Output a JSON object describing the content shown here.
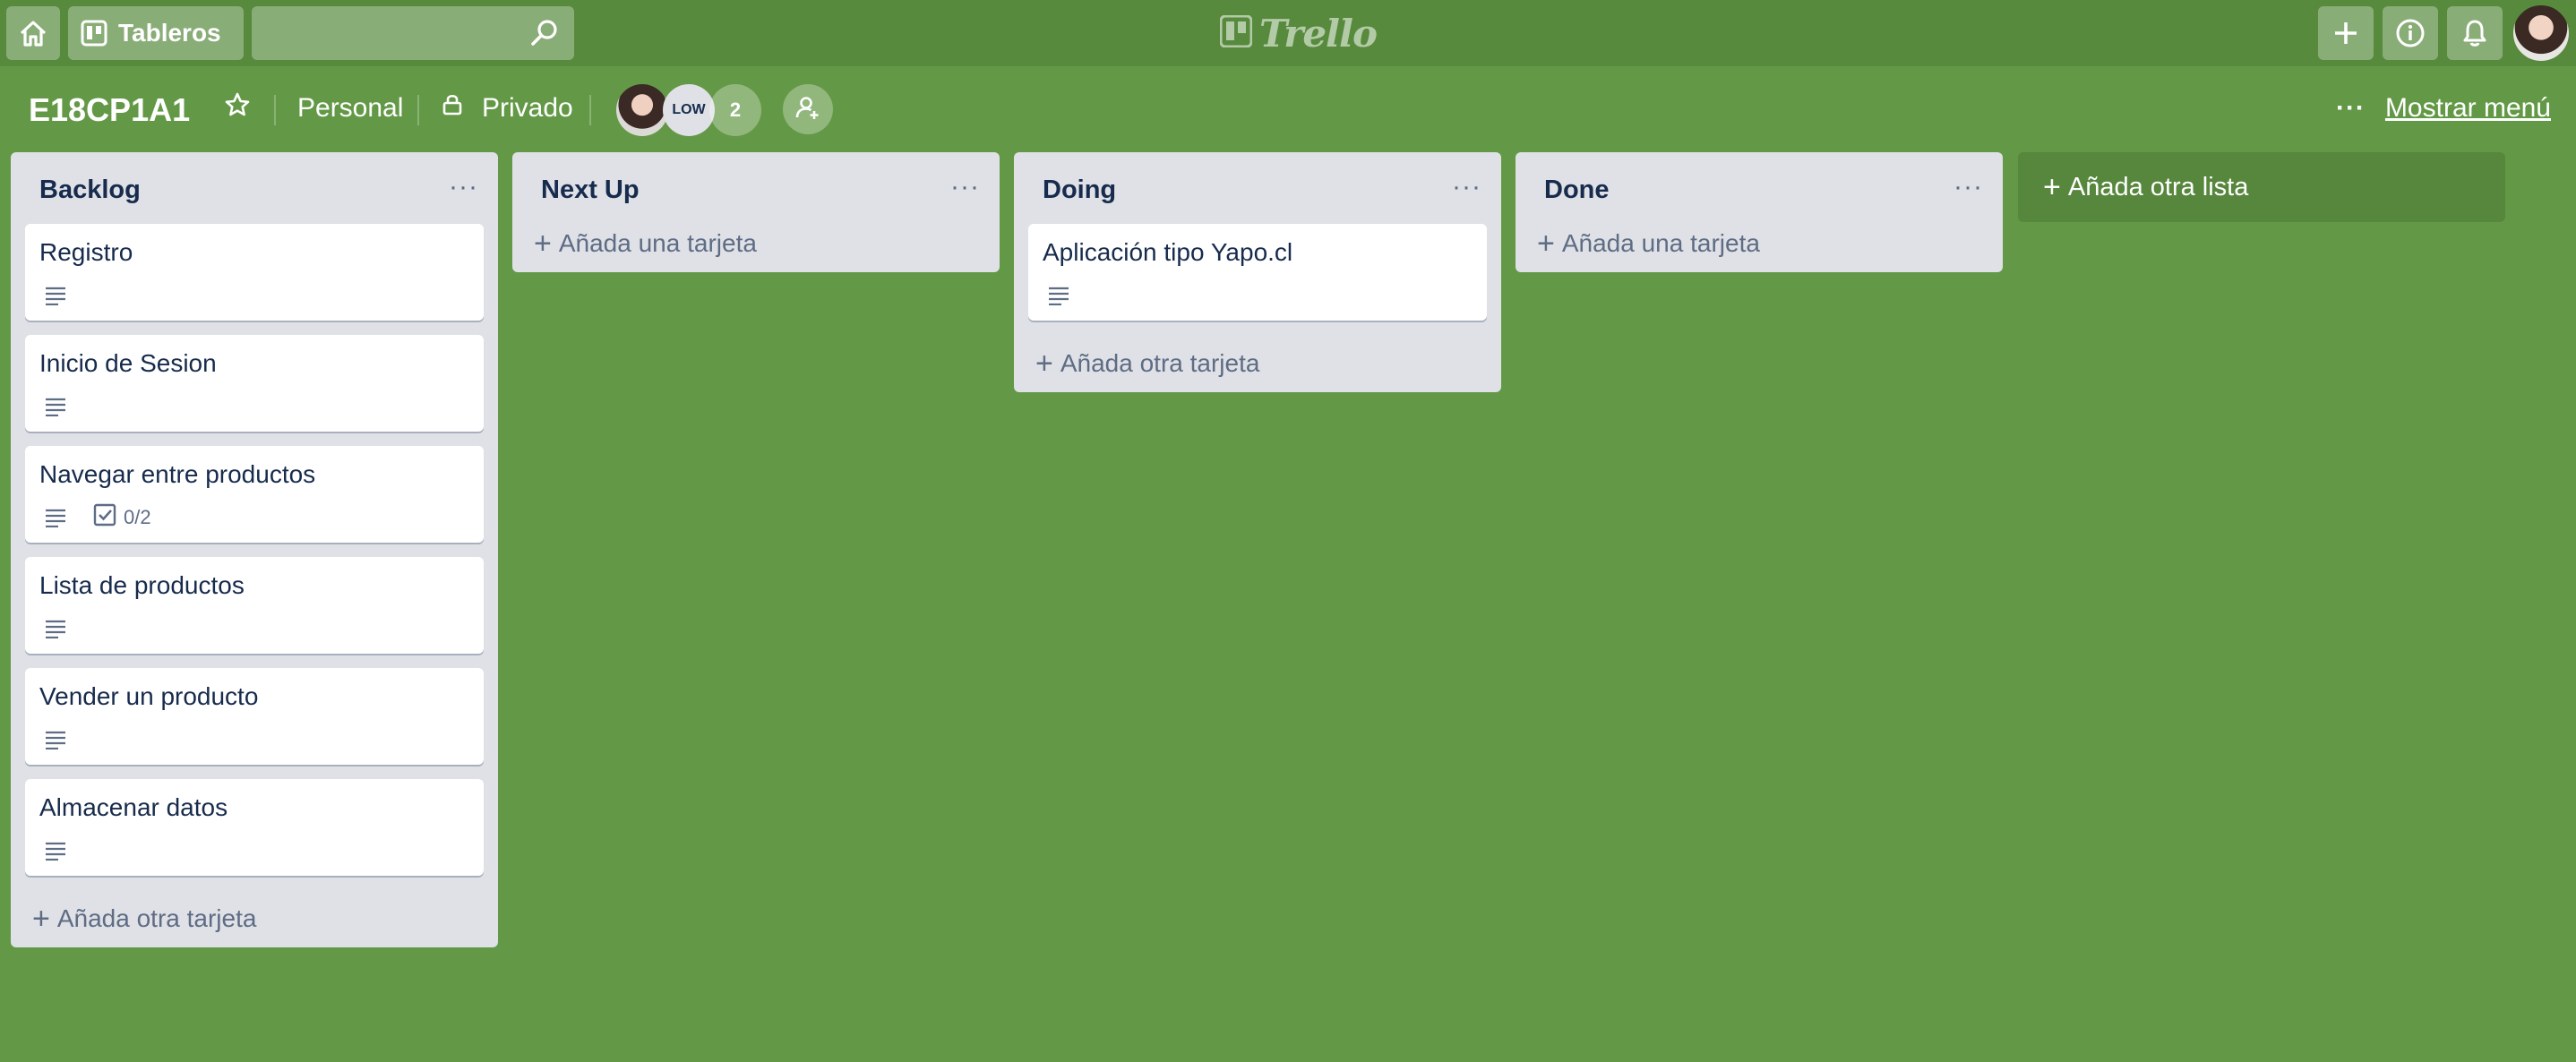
{
  "topbar": {
    "boards_label": "Tableros",
    "search_value": "",
    "logo_text": "Trello"
  },
  "board": {
    "title": "E18CP1A1",
    "team": "Personal",
    "visibility": "Privado",
    "member_badge": "LOW",
    "member_count": "2",
    "more_dots": "···",
    "show_menu": "Mostrar menú"
  },
  "lists": [
    {
      "title": "Backlog",
      "cards": [
        {
          "title": "Registro",
          "has_description": true
        },
        {
          "title": "Inicio de Sesion",
          "has_description": true
        },
        {
          "title": "Navegar entre productos",
          "has_description": true,
          "checklist": "0/2"
        },
        {
          "title": "Lista de productos",
          "has_description": true
        },
        {
          "title": "Vender un producto",
          "has_description": true
        },
        {
          "title": "Almacenar datos",
          "has_description": true
        }
      ],
      "add_label": "Añada otra tarjeta"
    },
    {
      "title": "Next Up",
      "cards": [],
      "add_label": "Añada una tarjeta"
    },
    {
      "title": "Doing",
      "cards": [
        {
          "title": "Aplicación tipo Yapo.cl",
          "has_description": true
        }
      ],
      "add_label": "Añada otra tarjeta"
    },
    {
      "title": "Done",
      "cards": [],
      "add_label": "Añada una tarjeta"
    }
  ],
  "add_list_label": "Añada otra lista",
  "list_menu": "···",
  "colors": {
    "background": "#639946",
    "header": "#578a3d",
    "list": "#dfe1e6"
  }
}
